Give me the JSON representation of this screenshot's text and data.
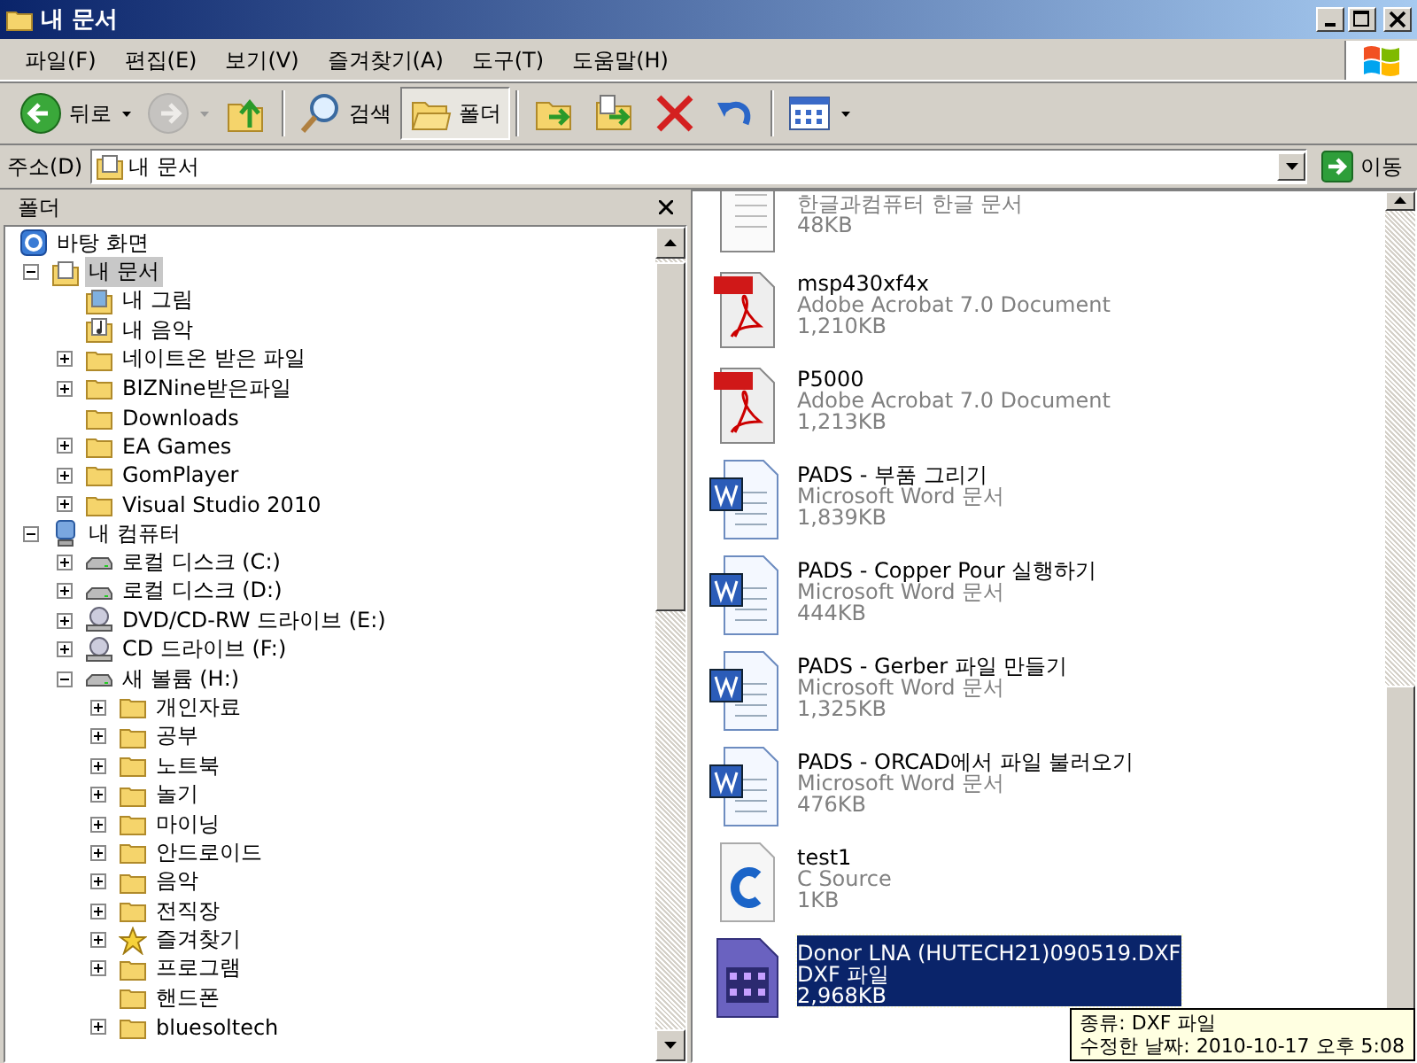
{
  "window": {
    "title": "내 문서"
  },
  "menu": [
    "파일(F)",
    "편집(E)",
    "보기(V)",
    "즐겨찾기(A)",
    "도구(T)",
    "도움말(H)"
  ],
  "toolbar": [
    {
      "kind": "back",
      "label": "뒤로",
      "dropdown": true,
      "disabled": false
    },
    {
      "kind": "forward",
      "dropdown": true,
      "disabled": true
    },
    {
      "kind": "up"
    },
    {
      "kind": "separator"
    },
    {
      "kind": "search",
      "label": "검색",
      "selected": false
    },
    {
      "kind": "folders",
      "label": "폴더",
      "selected": true
    },
    {
      "kind": "separator"
    },
    {
      "kind": "move"
    },
    {
      "kind": "copy"
    },
    {
      "kind": "delete"
    },
    {
      "kind": "undo"
    },
    {
      "kind": "separator"
    },
    {
      "kind": "views",
      "dropdown": true
    }
  ],
  "address": {
    "label": "주소(D)",
    "value": "내 문서",
    "go_label": "이동"
  },
  "folder_pane": {
    "title": "폴더",
    "tree": [
      {
        "label": "바탕 화면",
        "kind": "desktop",
        "selected": false,
        "children": [
          {
            "label": "내 문서",
            "kind": "documents",
            "selected": true,
            "expanded": true,
            "children": [
              {
                "label": "내 그림",
                "kind": "pictures",
                "selected": false
              },
              {
                "label": "내 음악",
                "kind": "music",
                "selected": false
              },
              {
                "label": "네이트온 받은 파일",
                "kind": "folder",
                "selected": false,
                "expanded": false
              },
              {
                "label": "BIZNine받은파일",
                "kind": "folder",
                "selected": false,
                "expanded": false
              },
              {
                "label": "Downloads",
                "kind": "folder",
                "selected": false
              },
              {
                "label": "EA Games",
                "kind": "folder",
                "selected": false,
                "expanded": false
              },
              {
                "label": "GomPlayer",
                "kind": "folder",
                "selected": false,
                "expanded": false
              },
              {
                "label": "Visual Studio 2010",
                "kind": "folder",
                "selected": false,
                "expanded": false
              }
            ]
          },
          {
            "label": "내 컴퓨터",
            "kind": "computer",
            "selected": false,
            "expanded": true,
            "children": [
              {
                "label": "로컬 디스크 (C:)",
                "kind": "drive",
                "selected": false,
                "expanded": false
              },
              {
                "label": "로컬 디스크 (D:)",
                "kind": "drive",
                "selected": false,
                "expanded": false
              },
              {
                "label": "DVD/CD-RW 드라이브 (E:)",
                "kind": "cdrom",
                "selected": false,
                "expanded": false
              },
              {
                "label": "CD 드라이브 (F:)",
                "kind": "cdrom",
                "selected": false,
                "expanded": false
              },
              {
                "label": "새 볼륨 (H:)",
                "kind": "drive",
                "selected": false,
                "expanded": true,
                "children": [
                  {
                    "label": "개인자료",
                    "kind": "folder",
                    "selected": false,
                    "expanded": false
                  },
                  {
                    "label": "공부",
                    "kind": "folder",
                    "selected": false,
                    "expanded": false
                  },
                  {
                    "label": "노트북",
                    "kind": "folder",
                    "selected": false,
                    "expanded": false
                  },
                  {
                    "label": "놀기",
                    "kind": "folder",
                    "selected": false,
                    "expanded": false
                  },
                  {
                    "label": "마이닝",
                    "kind": "folder",
                    "selected": false,
                    "expanded": false
                  },
                  {
                    "label": "안드로이드",
                    "kind": "folder",
                    "selected": false,
                    "expanded": false
                  },
                  {
                    "label": "음악",
                    "kind": "folder",
                    "selected": false,
                    "expanded": false
                  },
                  {
                    "label": "전직장",
                    "kind": "folder",
                    "selected": false,
                    "expanded": false
                  },
                  {
                    "label": "즐겨찾기",
                    "kind": "favorites",
                    "selected": false,
                    "expanded": false
                  },
                  {
                    "label": "프로그램",
                    "kind": "folder",
                    "selected": false,
                    "expanded": false
                  },
                  {
                    "label": "핸드폰",
                    "kind": "folder",
                    "selected": false
                  },
                  {
                    "label": "bluesoltech",
                    "kind": "folder",
                    "selected": false,
                    "expanded": false
                  }
                ]
              }
            ]
          }
        ]
      }
    ]
  },
  "files": [
    {
      "kind": "hwp",
      "type": "한글과컴퓨터 한글 문서",
      "size": "48KB",
      "selected": false
    },
    {
      "kind": "pdf",
      "name": "msp430xf4x",
      "type": "Adobe Acrobat 7.0 Document",
      "size": "1,210KB",
      "selected": false
    },
    {
      "kind": "pdf",
      "name": "P5000",
      "type": "Adobe Acrobat 7.0 Document",
      "size": "1,213KB",
      "selected": false
    },
    {
      "kind": "word",
      "name": "PADS - 부품 그리기",
      "type": "Microsoft Word 문서",
      "size": "1,839KB",
      "selected": false
    },
    {
      "kind": "word",
      "name": "PADS - Copper Pour 실행하기",
      "type": "Microsoft Word 문서",
      "size": "444KB",
      "selected": false
    },
    {
      "kind": "word",
      "name": "PADS - Gerber 파일 만들기",
      "type": "Microsoft Word 문서",
      "size": "1,325KB",
      "selected": false
    },
    {
      "kind": "word",
      "name": "PADS - ORCAD에서 파일 불러오기",
      "type": "Microsoft Word 문서",
      "size": "476KB",
      "selected": false
    },
    {
      "kind": "c",
      "name": "test1",
      "type": "C Source",
      "size": "1KB",
      "selected": false
    },
    {
      "kind": "dxf",
      "name": "Donor LNA (HUTECH21)090519.DXF",
      "type": "DXF 파일",
      "size": "2,968KB",
      "selected": true
    }
  ],
  "tooltip": [
    "종류: DXF 파일",
    "수정한 날짜: 2010-10-17 오후 5:08"
  ]
}
